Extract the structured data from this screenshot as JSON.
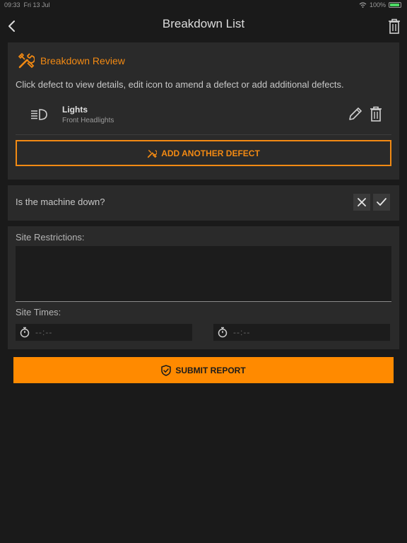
{
  "status_bar": {
    "time": "09:33",
    "date": "Fri 13 Jul",
    "battery": "100%"
  },
  "nav": {
    "title": "Breakdown List",
    "back_icon": "chevron-left-icon",
    "trash_icon": "trash-icon"
  },
  "review": {
    "title": "Breakdown Review",
    "description": "Click defect to view details, edit icon to amend a defect or add additional defects.",
    "defects": [
      {
        "name": "Lights",
        "subtitle": "Front Headlights",
        "icon": "headlight-icon"
      }
    ],
    "add_button": "ADD ANOTHER DEFECT"
  },
  "machine_down": {
    "question": "Is the machine down?",
    "no_icon": "cross-icon",
    "yes_icon": "check-icon"
  },
  "site": {
    "restrictions_label": "Site Restrictions:",
    "restrictions_value": "",
    "times_label": "Site Times:",
    "time_start_placeholder": "--:--",
    "time_end_placeholder": "--:--"
  },
  "submit": {
    "label": "SUBMIT REPORT",
    "icon": "shield-check-icon"
  },
  "colors": {
    "accent": "#f38a13",
    "submit_bg": "#ff8a00",
    "background": "#1a1a1a",
    "card": "#2a2a2a"
  }
}
